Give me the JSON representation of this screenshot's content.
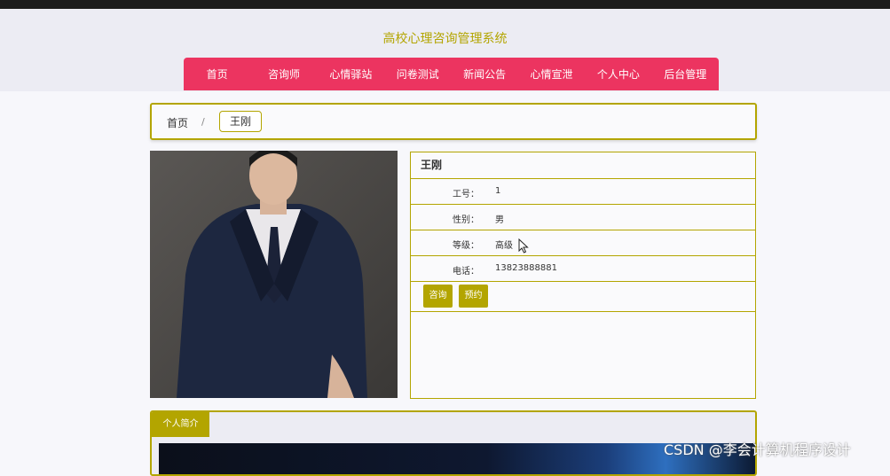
{
  "site": {
    "title": "高校心理咨询管理系统"
  },
  "nav": {
    "items": [
      {
        "label": "首页"
      },
      {
        "label": "咨询师"
      },
      {
        "label": "心情驿站"
      },
      {
        "label": "问卷测试"
      },
      {
        "label": "新闻公告"
      },
      {
        "label": "心情宣泄"
      },
      {
        "label": "个人中心"
      },
      {
        "label": "后台管理"
      }
    ]
  },
  "breadcrumb": {
    "home": "首页",
    "separator": "/",
    "current": "王刚"
  },
  "counselor": {
    "name": "王刚",
    "fields": [
      {
        "label": "工号：",
        "value": "1"
      },
      {
        "label": "性别：",
        "value": "男"
      },
      {
        "label": "等级：",
        "value": "高级"
      },
      {
        "label": "电话：",
        "value": "13823888881"
      }
    ],
    "consult_label": "咨询",
    "book_label": "预约"
  },
  "intro": {
    "tab_label": "个人简介"
  },
  "watermark": "CSDN @李会计算机程序设计",
  "colors": {
    "accent": "#b3a500",
    "nav": "#ec3460",
    "header_bg": "#ececf3"
  },
  "icons": {
    "cursor": "mouse-pointer-icon"
  }
}
